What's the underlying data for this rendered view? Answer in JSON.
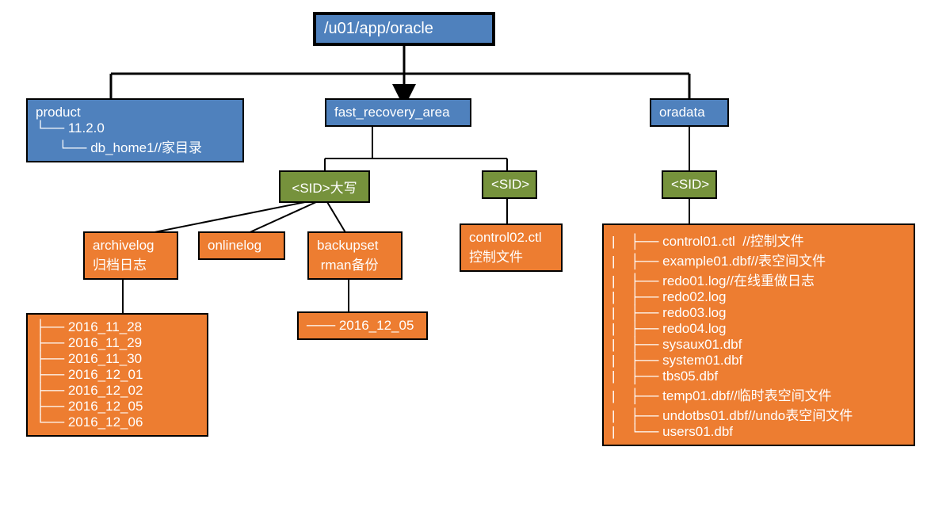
{
  "root": "/u01/app/oracle",
  "product": {
    "title": "product",
    "line1": "└── 11.2.0",
    "line2": "      └── db_home1//家目录"
  },
  "fra": {
    "title": "fast_recovery_area",
    "sid_upper": "<SID>大写",
    "sid": "<SID>",
    "archivelog": {
      "name": "archivelog",
      "sub": "归档日志"
    },
    "onlinelog": "onlinelog",
    "backupset": {
      "name": "backupset",
      "sub": " rman备份"
    },
    "backupset_dates": "─── 2016_12_05",
    "control02": {
      "name": "control02.ctl",
      "sub": "控制文件"
    },
    "archivelog_dates": [
      "├── 2016_11_28",
      "├── 2016_11_29",
      "├── 2016_11_30",
      "├── 2016_12_01",
      "├── 2016_12_02",
      "├── 2016_12_05",
      "└── 2016_12_06"
    ]
  },
  "oradata": {
    "title": "oradata",
    "sid": "<SID>",
    "files": [
      "|    ├── control01.ctl  //控制文件",
      "|    ├── example01.dbf//表空间文件",
      "|    ├── redo01.log//在线重做日志",
      "|    ├── redo02.log",
      "|    ├── redo03.log",
      "|    ├── redo04.log",
      "|    ├── sysaux01.dbf",
      "|    ├── system01.dbf",
      "|    ├── tbs05.dbf",
      "|    ├── temp01.dbf//临时表空间文件",
      "|    ├── undotbs01.dbf//undo表空间文件",
      "|    └── users01.dbf"
    ]
  }
}
